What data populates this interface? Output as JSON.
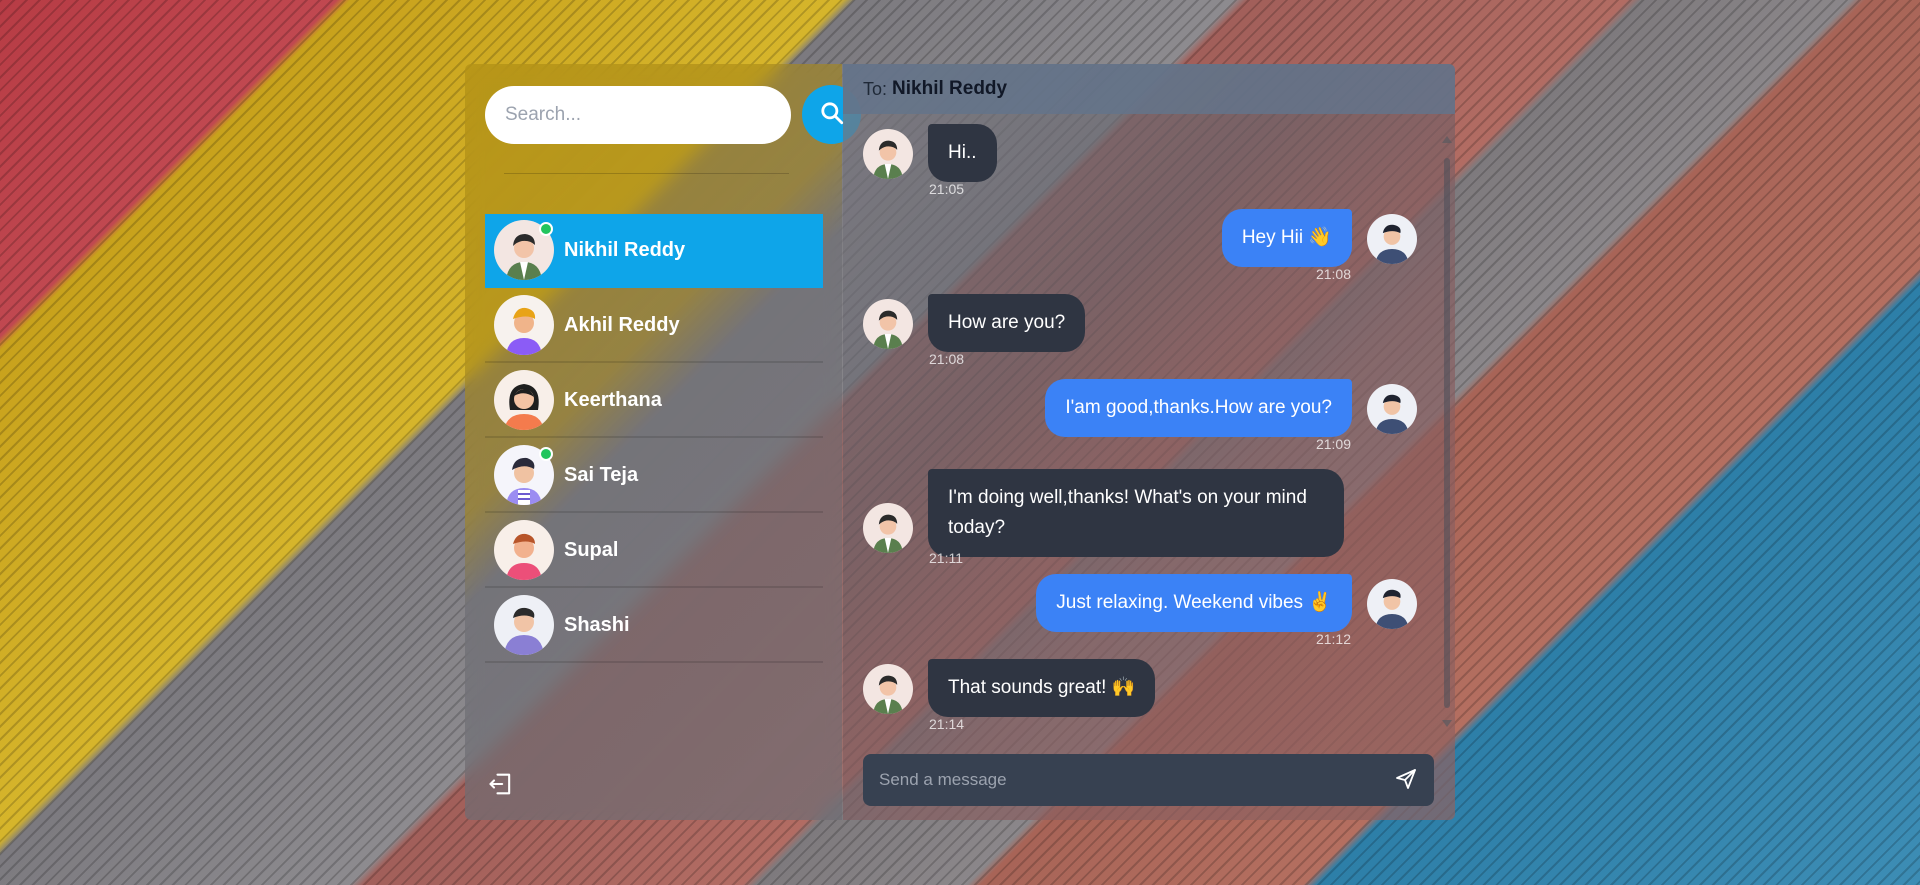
{
  "sidebar": {
    "search": {
      "placeholder": "Search...",
      "value": ""
    },
    "contacts": [
      {
        "name": "Nikhil Reddy",
        "online": true,
        "active": true,
        "avatar": "avatar-male-green"
      },
      {
        "name": "Akhil Reddy",
        "online": false,
        "active": false,
        "avatar": "avatar-male-purple"
      },
      {
        "name": "Keerthana",
        "online": false,
        "active": false,
        "avatar": "avatar-female-orange"
      },
      {
        "name": "Sai Teja",
        "online": true,
        "active": false,
        "avatar": "avatar-male-striped"
      },
      {
        "name": "Supal",
        "online": false,
        "active": false,
        "avatar": "avatar-male-pink"
      },
      {
        "name": "Shashi",
        "online": false,
        "active": false,
        "avatar": "avatar-male-hoodie"
      }
    ],
    "logout_icon": "logout-icon"
  },
  "chat": {
    "to_label": "To:",
    "to_name": "Nikhil Reddy",
    "messages": [
      {
        "from": "them",
        "text": "Hi..",
        "time": "21:05"
      },
      {
        "from": "me",
        "text": "Hey Hii 👋",
        "time": "21:08"
      },
      {
        "from": "them",
        "text": "How are you?",
        "time": "21:08"
      },
      {
        "from": "me",
        "text": "I'am good,thanks.How are you?",
        "time": "21:09"
      },
      {
        "from": "them",
        "text": "I'm doing well,thanks! What's on your mind today?",
        "time": "21:11"
      },
      {
        "from": "me",
        "text": "Just relaxing. Weekend vibes ✌️",
        "time": "21:12"
      },
      {
        "from": "them",
        "text": "That sounds great! 🙌",
        "time": "21:14"
      }
    ],
    "composer": {
      "placeholder": "Send a message",
      "value": ""
    }
  },
  "colors": {
    "accent": "#0ea5e9",
    "outgoing_bubble": "#3b82f6",
    "incoming_bubble": "#2f3542",
    "online": "#22c55e"
  }
}
